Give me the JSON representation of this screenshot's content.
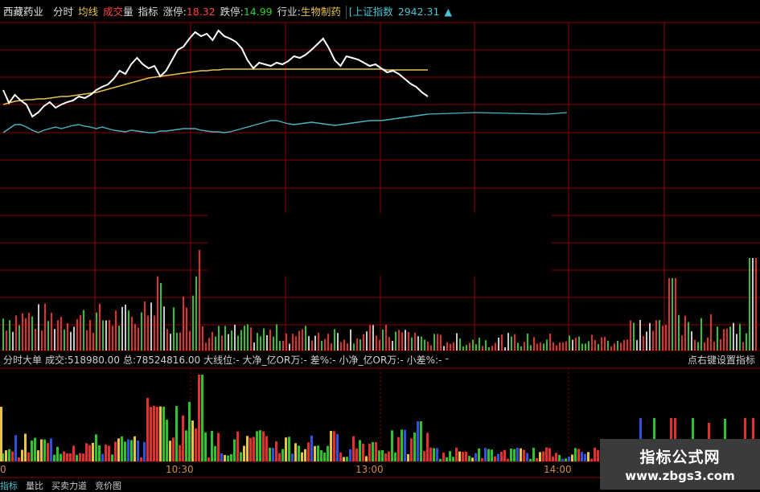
{
  "header": {
    "stock_name": "西藏药业",
    "tab_time": "分时",
    "tab_avg": "均线",
    "tab_volume_a": "成交",
    "tab_volume_b": "量",
    "tab_indicator": "指标",
    "limit_up_label": "涨停:",
    "limit_up_value": "18.32",
    "limit_down_label": "跌停:",
    "limit_down_value": "14.99",
    "industry_label": "行业:",
    "industry_value": "生物制药",
    "index_name": "[上证指数",
    "index_value": "2942.31",
    "index_arrow": "▲"
  },
  "indicator_header": {
    "name": "分时大单",
    "volume": "成交:518980.00",
    "total": "总:78524816.00",
    "big_level": "大线位:-",
    "big_net": "大净_亿OR万:-",
    "diff": "差%:-",
    "small_net": "小净_亿OR万:-",
    "small_diff": "小差%:-",
    "extra": "-",
    "right_hint": "点右键设置指标"
  },
  "time_axis": [
    "0",
    "10:30",
    "13:00",
    "14:00"
  ],
  "bottom_tabs": [
    "指标",
    "量比",
    "买卖力道",
    "竞价图"
  ],
  "watermark": {
    "line1": "指标公式网",
    "line2": "www.zbgs3.com"
  },
  "colors": {
    "grid": "#8a0000",
    "price_line": "#ffffff",
    "avg_line": "#e6c24a",
    "index_line": "#46b4c3",
    "up": "#e03030",
    "down": "#30c030",
    "neutral": "#c8c8c8",
    "big_buy": "#e03030",
    "big_sell": "#30c030",
    "mid": "#e6c24a",
    "blue": "#3050e0"
  },
  "chart_data": {
    "type": "line",
    "title": "西藏药业 分时",
    "price_series": [
      112,
      128,
      118,
      125,
      130,
      145,
      140,
      132,
      127,
      134,
      130,
      127,
      125,
      120,
      122,
      118,
      112,
      108,
      105,
      98,
      88,
      92,
      80,
      72,
      80,
      85,
      82,
      95,
      88,
      75,
      62,
      58,
      48,
      40,
      45,
      42,
      50,
      38,
      45,
      48,
      52,
      60,
      75,
      85,
      78,
      80,
      82,
      78,
      80,
      76,
      70,
      72,
      68,
      62,
      55,
      48,
      60,
      75,
      82,
      70,
      72,
      74,
      78,
      82,
      80,
      85,
      90,
      88,
      92,
      98,
      104,
      108,
      115,
      120
    ],
    "avg_series": [
      130,
      128,
      126,
      125,
      124,
      124,
      123,
      123,
      122,
      121,
      120,
      120,
      119,
      118,
      117,
      116,
      115,
      113,
      111,
      109,
      107,
      105,
      103,
      101,
      99,
      97,
      96,
      95,
      94,
      93,
      92,
      91,
      90,
      89,
      88,
      88,
      87,
      87,
      86,
      86,
      86,
      86,
      86,
      86,
      86,
      86,
      86,
      86,
      86,
      86,
      86,
      86,
      86,
      86,
      86,
      86,
      86,
      86,
      86,
      86,
      86,
      86,
      86,
      86,
      86,
      86,
      87,
      87,
      87,
      87,
      87,
      87,
      87,
      87
    ],
    "index_series": [
      165,
      160,
      155,
      155,
      158,
      162,
      165,
      162,
      160,
      158,
      160,
      158,
      156,
      155,
      157,
      158,
      160,
      158,
      160,
      162,
      163,
      164,
      162,
      163,
      164,
      165,
      165,
      163,
      163,
      162,
      161,
      160,
      160,
      160,
      162,
      163,
      164,
      164,
      165,
      164,
      162,
      160,
      158,
      156,
      154,
      152,
      150,
      150,
      152,
      154,
      155,
      154,
      153,
      152,
      153,
      154,
      155,
      156,
      155,
      154,
      153,
      152,
      151,
      150,
      150,
      150,
      149,
      148,
      147,
      146,
      145,
      144,
      143,
      142
    ]
  }
}
